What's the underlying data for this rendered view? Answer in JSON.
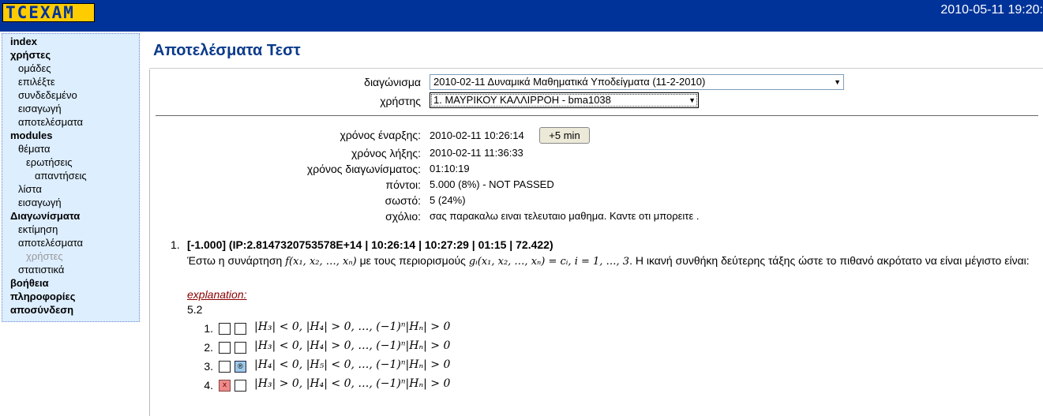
{
  "header": {
    "logo_text": "TCEXAM",
    "datetime": "2010-05-11 19:20:"
  },
  "menu": {
    "items": [
      {
        "label": "index",
        "level": 0
      },
      {
        "label": "χρήστες",
        "level": 0
      },
      {
        "label": "ομάδες",
        "level": 1
      },
      {
        "label": "επιλέξτε",
        "level": 1
      },
      {
        "label": "συνδεδεμένο",
        "level": 1
      },
      {
        "label": "εισαγωγή",
        "level": 1
      },
      {
        "label": "αποτελέσματα",
        "level": 1
      },
      {
        "label": "modules",
        "level": 0
      },
      {
        "label": "θέματα",
        "level": 1
      },
      {
        "label": "ερωτήσεις",
        "level": 2
      },
      {
        "label": "απαντήσεις",
        "level": 3
      },
      {
        "label": "λίστα",
        "level": 1
      },
      {
        "label": "εισαγωγή",
        "level": 1
      },
      {
        "label": "Διαγωνίσματα",
        "level": 0
      },
      {
        "label": "εκτίμηση",
        "level": 1
      },
      {
        "label": "αποτελέσματα",
        "level": 1
      },
      {
        "label": "χρήστες",
        "level": 2,
        "disabled": true
      },
      {
        "label": "στατιστικά",
        "level": 1
      },
      {
        "label": "βοήθεια",
        "level": 0
      },
      {
        "label": "πληροφορίες",
        "level": 0
      },
      {
        "label": "αποσύνδεση",
        "level": 0
      }
    ]
  },
  "page": {
    "title": "Αποτελέσματα Τεστ"
  },
  "form": {
    "test_label": "διαγώνισμα",
    "test_value": "2010-02-11 Δυναμικά Μαθηματικά Υποδείγματα (11-2-2010)",
    "user_label": "χρήστης",
    "user_value": "1. ΜΑΥΡΙΚΟΥ ΚΑΛΛΙΡΡΟΗ - bma1038"
  },
  "info": {
    "start_label": "χρόνος έναρξης:",
    "start_value": "2010-02-11 10:26:14",
    "plus5_label": "+5 min",
    "end_label": "χρόνος λήξης:",
    "end_value": "2010-02-11 11:36:33",
    "duration_label": "χρόνος διαγωνίσματος:",
    "duration_value": "01:10:19",
    "points_label": "πόντοι:",
    "points_value": "5.000 (8%) - NOT PASSED",
    "correct_label": "σωστό:",
    "correct_value": "5 (24%)",
    "comment_label": "σχόλιο:",
    "comment_value": "σας παρακαλω ειναι τελευταιο μαθημα. Καντε οτι μπορειτε ."
  },
  "question": {
    "number": "1.",
    "header": "[-1.000] (IP:2.8147320753578E+14 | 10:26:14 | 10:27:29 | 01:15 | 72.422)",
    "text_1": "Έστω η συνάρτηση",
    "math_f": "f(x₁, x₂, …, xₙ)",
    "text_2": "με τους περιορισμούς",
    "math_g": "gᵢ(x₁, x₂, …, xₙ) = cᵢ, i = 1, …, 3",
    "text_3": ". Η ικανή συνθήκη δεύτερης τάξης ώστε το πιθανό ακρότατο να είναι μέγιστο είναι:",
    "explanation_label": "explanation:",
    "explanation_text": "5.2",
    "answers": [
      {
        "num": "1.",
        "text": "|H₃| < 0, |H₄| > 0, …, (−1)ⁿ|Hₙ| > 0",
        "box1": "",
        "box2": ""
      },
      {
        "num": "2.",
        "text": "|H₃| < 0, |H₄| > 0, …, (−1)ⁿ|Hₙ| > 0",
        "box1": "",
        "box2": ""
      },
      {
        "num": "3.",
        "text": "|H₄| < 0, |H₅| < 0, …, (−1)ⁿ|Hₙ| > 0",
        "box1": "",
        "box2": "®"
      },
      {
        "num": "4.",
        "text": "|H₃| > 0, |H₄| < 0, …, (−1)ⁿ|Hₙ| > 0",
        "box1": "x",
        "box2": ""
      }
    ]
  },
  "colors": {
    "topbar": "#003399",
    "logo_bg": "#ffcc00",
    "menu_bg": "#ddeeff",
    "title": "#0a3a8a",
    "explanation": "#8b0000",
    "selected_box": "#9ec9e8",
    "wrong_box": "#ef8a8a"
  }
}
